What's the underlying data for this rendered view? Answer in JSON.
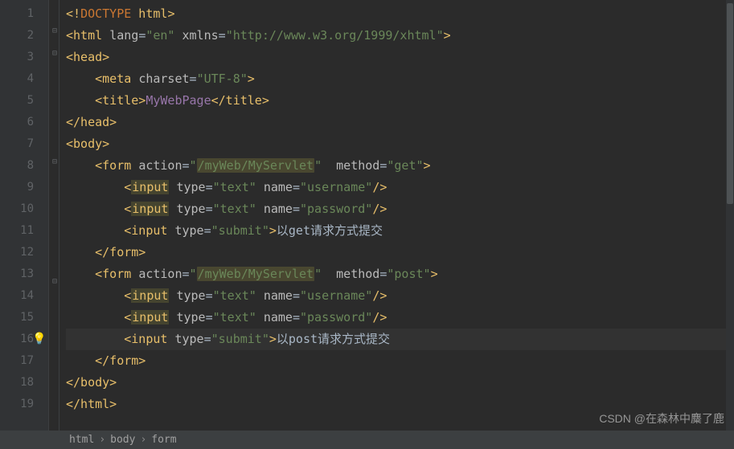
{
  "lines": {
    "l1": "1",
    "l2": "2",
    "l3": "3",
    "l4": "4",
    "l5": "5",
    "l6": "6",
    "l7": "7",
    "l8": "8",
    "l9": "9",
    "l10": "10",
    "l11": "11",
    "l12": "12",
    "l13": "13",
    "l14": "14",
    "l15": "15",
    "l16": "16",
    "l17": "17",
    "l18": "18",
    "l19": "19"
  },
  "code": {
    "doctype_open": "<!",
    "doctype": "DOCTYPE",
    "doctype_val": " html",
    "doctype_close": ">",
    "html_open": "<html ",
    "lang_attr": "lang",
    "eq": "=",
    "lang_val": "\"en\"",
    "sp": " ",
    "xmlns_attr": "xmlns",
    "xmlns_val": "\"http://www.w3.org/1999/xhtml\"",
    "tag_close": ">",
    "head_open": "<head>",
    "meta_open": "    <meta ",
    "charset_attr": "charset",
    "charset_val": "\"UTF-8\"",
    "meta_close": ">",
    "title_open": "    <title>",
    "title_text": "MyWebPage",
    "title_close": "</title>",
    "head_close": "</head>",
    "body_open": "<body>",
    "form_open1": "    <form ",
    "action_attr": "action",
    "action_val": "\"/myWeb/MyServlet\"",
    "action_val_hl": "/myWeb/MyServlet",
    "q": "\"",
    "space2": "  ",
    "method_attr": "method",
    "method_get": "\"get\"",
    "method_post": "\"post\"",
    "input_pad": "        ",
    "input_open": "<",
    "input_tag": "input",
    "input_sp": " ",
    "type_attr": "type",
    "type_text": "\"text\"",
    "type_submit": "\"submit\"",
    "name_attr": "name",
    "name_user": "\"username\"",
    "name_pass": "\"password\"",
    "self_close": "/>",
    "close_br": ">",
    "submit_get_txt": "以get请求方式提交",
    "submit_post_txt": "以post请求方式提交",
    "form_close": "    </form>",
    "body_close": "</body>",
    "html_close": "</html>"
  },
  "breadcrumbs": {
    "b1": "html",
    "b2": "body",
    "b3": "form",
    "sep": "›"
  },
  "watermark": "CSDN @在森林中麋了鹿",
  "bulb": "💡"
}
